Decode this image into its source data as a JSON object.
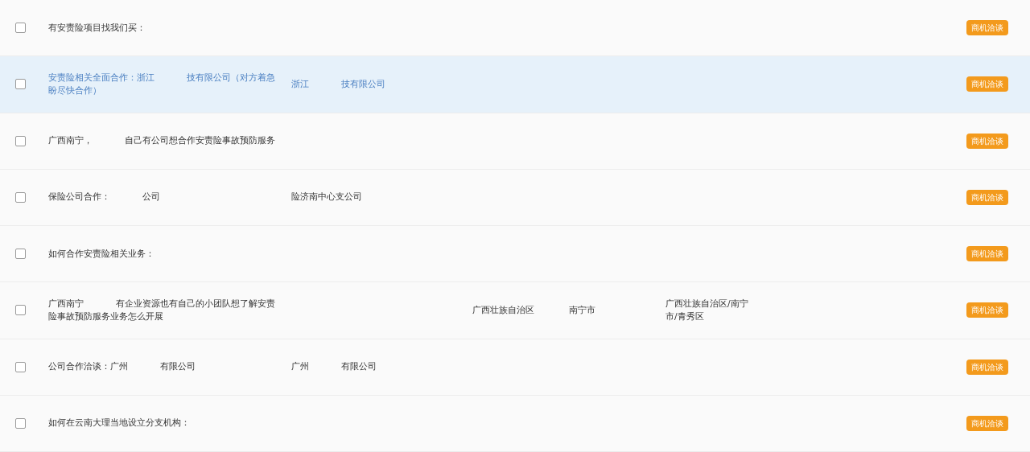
{
  "rows": [
    {
      "checked": false,
      "selected": false,
      "title": [
        "有安责险项目找我们买："
      ],
      "badge": "商机洽谈"
    },
    {
      "checked": false,
      "selected": true,
      "title": [
        "安责险相关全面合作：浙江",
        "技有限公司（对方着急盼尽快合作）"
      ],
      "company": [
        "浙江",
        "技有限公司"
      ],
      "badge": "商机洽谈"
    },
    {
      "checked": false,
      "selected": false,
      "title": [
        "广西南宁，",
        "自己有公司想合作安责险事故预防服务"
      ],
      "badge": "商机洽谈"
    },
    {
      "checked": false,
      "selected": false,
      "title": [
        "保险公司合作：",
        "公司"
      ],
      "company": [
        "险济南中心支公司"
      ],
      "badge": "商机洽谈"
    },
    {
      "checked": false,
      "selected": false,
      "title": [
        "如何合作安责险相关业务："
      ],
      "badge": "商机洽谈"
    },
    {
      "checked": false,
      "selected": false,
      "title": [
        "广西南宁",
        "有企业资源也有自己的小团队想了解安责险事故预防服务业务怎么开展"
      ],
      "province": "广西壮族自治区",
      "city": "南宁市",
      "address": "广西壮族自治区/南宁市/青秀区",
      "badge": "商机洽谈"
    },
    {
      "checked": false,
      "selected": false,
      "title": [
        "公司合作洽谈：广州",
        "有限公司"
      ],
      "company": [
        "广州",
        "有限公司"
      ],
      "badge": "商机洽谈"
    },
    {
      "checked": false,
      "selected": false,
      "title": [
        "如何在云南大理当地设立分支机构："
      ],
      "badge": "商机洽谈"
    }
  ]
}
